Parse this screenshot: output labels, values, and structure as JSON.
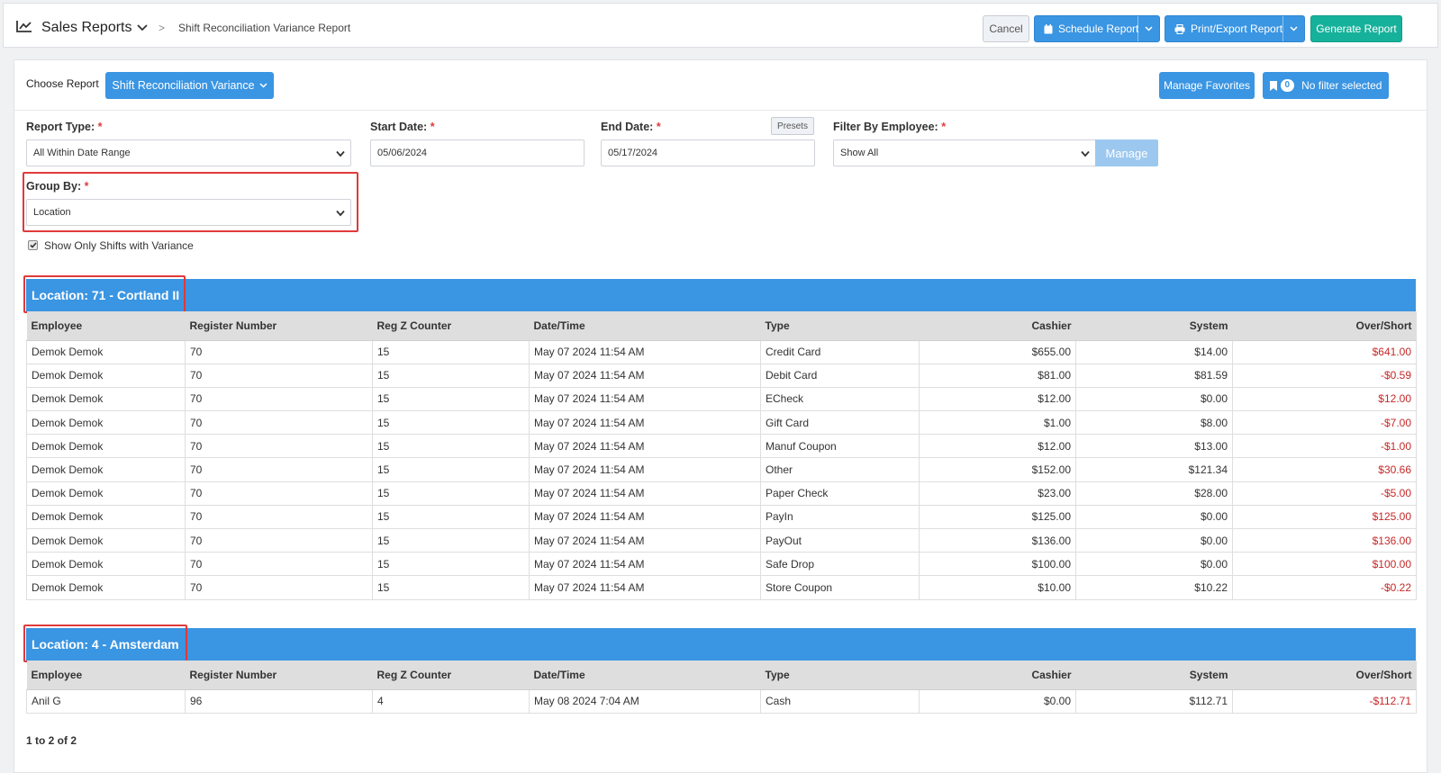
{
  "header": {
    "section": "Sales Reports",
    "breadcrumb_sep": ">",
    "current": "Shift Reconciliation Variance Report",
    "cancel": "Cancel",
    "schedule": "Schedule Report",
    "print_export": "Print/Export Report",
    "generate": "Generate Report"
  },
  "toolbar": {
    "choose_label": "Choose Report",
    "report_selected": "Shift Reconciliation Variance",
    "manage_favorites": "Manage Favorites",
    "filter_count": "0",
    "filter_text": "No filter selected"
  },
  "form": {
    "report_type_label": "Report Type:",
    "report_type_value": "All Within Date Range",
    "start_label": "Start Date:",
    "start_value": "05/06/2024",
    "end_label": "End Date:",
    "end_value": "05/17/2024",
    "presets": "Presets",
    "employee_label": "Filter By Employee:",
    "employee_value": "Show All",
    "manage": "Manage",
    "group_label": "Group By:",
    "group_value": "Location",
    "required_mark": "*",
    "variance_only_label": "Show Only Shifts with Variance",
    "variance_only_checked": true
  },
  "columns": [
    "Employee",
    "Register Number",
    "Reg Z Counter",
    "Date/Time",
    "Type",
    "Cashier",
    "System",
    "Over/Short"
  ],
  "groups": [
    {
      "title": "Location: 71 - Cortland II",
      "rows": [
        [
          "Demok Demok",
          "70",
          "15",
          "May 07 2024 11:54 AM",
          "Credit Card",
          "$655.00",
          "$14.00",
          "$641.00"
        ],
        [
          "Demok Demok",
          "70",
          "15",
          "May 07 2024 11:54 AM",
          "Debit Card",
          "$81.00",
          "$81.59",
          "-$0.59"
        ],
        [
          "Demok Demok",
          "70",
          "15",
          "May 07 2024 11:54 AM",
          "ECheck",
          "$12.00",
          "$0.00",
          "$12.00"
        ],
        [
          "Demok Demok",
          "70",
          "15",
          "May 07 2024 11:54 AM",
          "Gift Card",
          "$1.00",
          "$8.00",
          "-$7.00"
        ],
        [
          "Demok Demok",
          "70",
          "15",
          "May 07 2024 11:54 AM",
          "Manuf Coupon",
          "$12.00",
          "$13.00",
          "-$1.00"
        ],
        [
          "Demok Demok",
          "70",
          "15",
          "May 07 2024 11:54 AM",
          "Other",
          "$152.00",
          "$121.34",
          "$30.66"
        ],
        [
          "Demok Demok",
          "70",
          "15",
          "May 07 2024 11:54 AM",
          "Paper Check",
          "$23.00",
          "$28.00",
          "-$5.00"
        ],
        [
          "Demok Demok",
          "70",
          "15",
          "May 07 2024 11:54 AM",
          "PayIn",
          "$125.00",
          "$0.00",
          "$125.00"
        ],
        [
          "Demok Demok",
          "70",
          "15",
          "May 07 2024 11:54 AM",
          "PayOut",
          "$136.00",
          "$0.00",
          "$136.00"
        ],
        [
          "Demok Demok",
          "70",
          "15",
          "May 07 2024 11:54 AM",
          "Safe Drop",
          "$100.00",
          "$0.00",
          "$100.00"
        ],
        [
          "Demok Demok",
          "70",
          "15",
          "May 07 2024 11:54 AM",
          "Store Coupon",
          "$10.00",
          "$10.22",
          "-$0.22"
        ]
      ]
    },
    {
      "title": "Location: 4 - Amsterdam",
      "rows": [
        [
          "Anil G",
          "96",
          "4",
          "May 08 2024 7:04 AM",
          "Cash",
          "$0.00",
          "$112.71",
          "-$112.71"
        ]
      ]
    }
  ],
  "pager": "1 to 2 of 2",
  "colors": {
    "primary": "#3a95e2",
    "generate": "#16b19a",
    "negative": "#c62828",
    "highlight": "#e03a3a"
  }
}
